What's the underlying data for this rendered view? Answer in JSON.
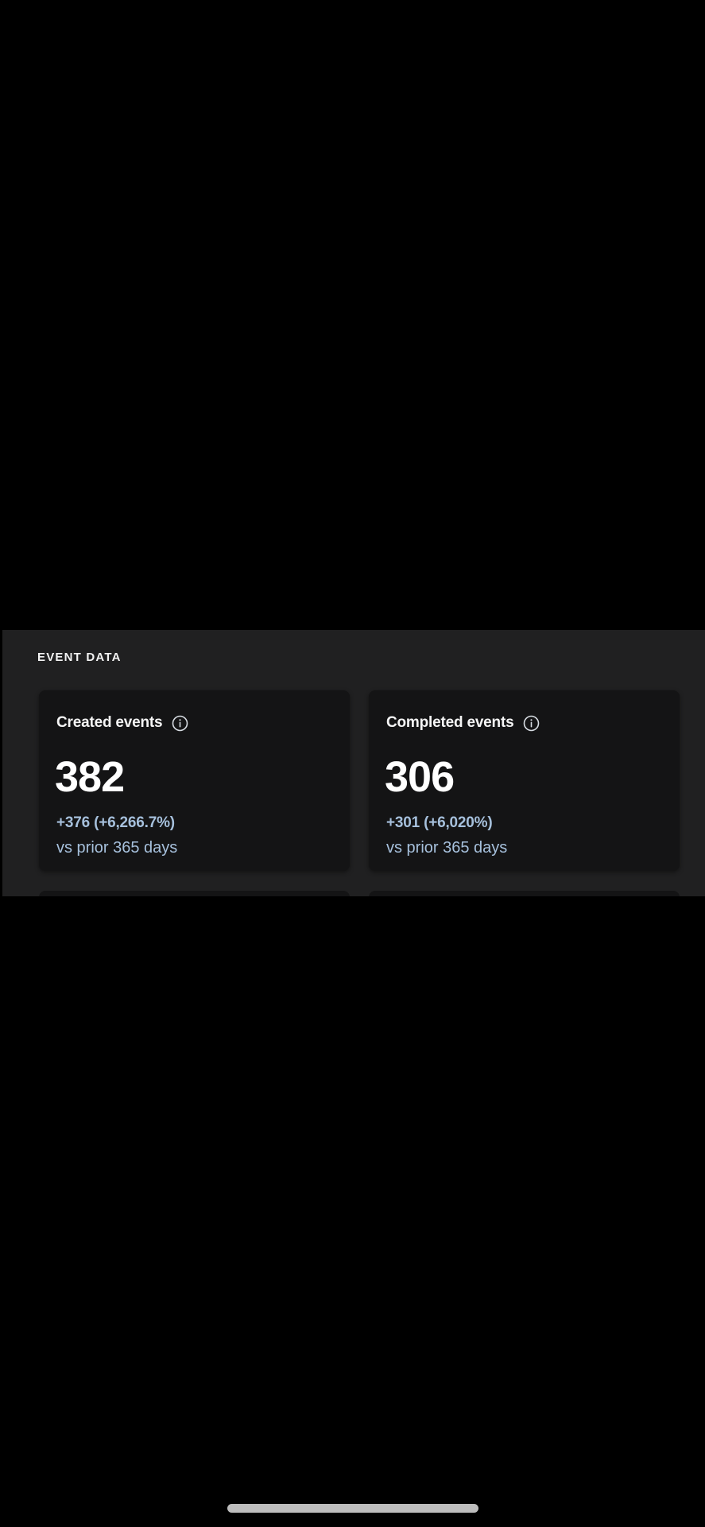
{
  "section": {
    "title": "EVENT DATA"
  },
  "cards": [
    {
      "label": "Created events",
      "value": "382",
      "delta": "+376 (+6,266.7%)",
      "comparison": "vs prior 365 days",
      "icon": "info-icon"
    },
    {
      "label": "Completed events",
      "value": "306",
      "delta": "+301 (+6,020%)",
      "comparison": "vs prior 365 days",
      "icon": "info-icon"
    }
  ],
  "colors": {
    "background": "#000000",
    "panel": "#202021",
    "card": "#141415",
    "accent_text": "#a6c0dc"
  }
}
